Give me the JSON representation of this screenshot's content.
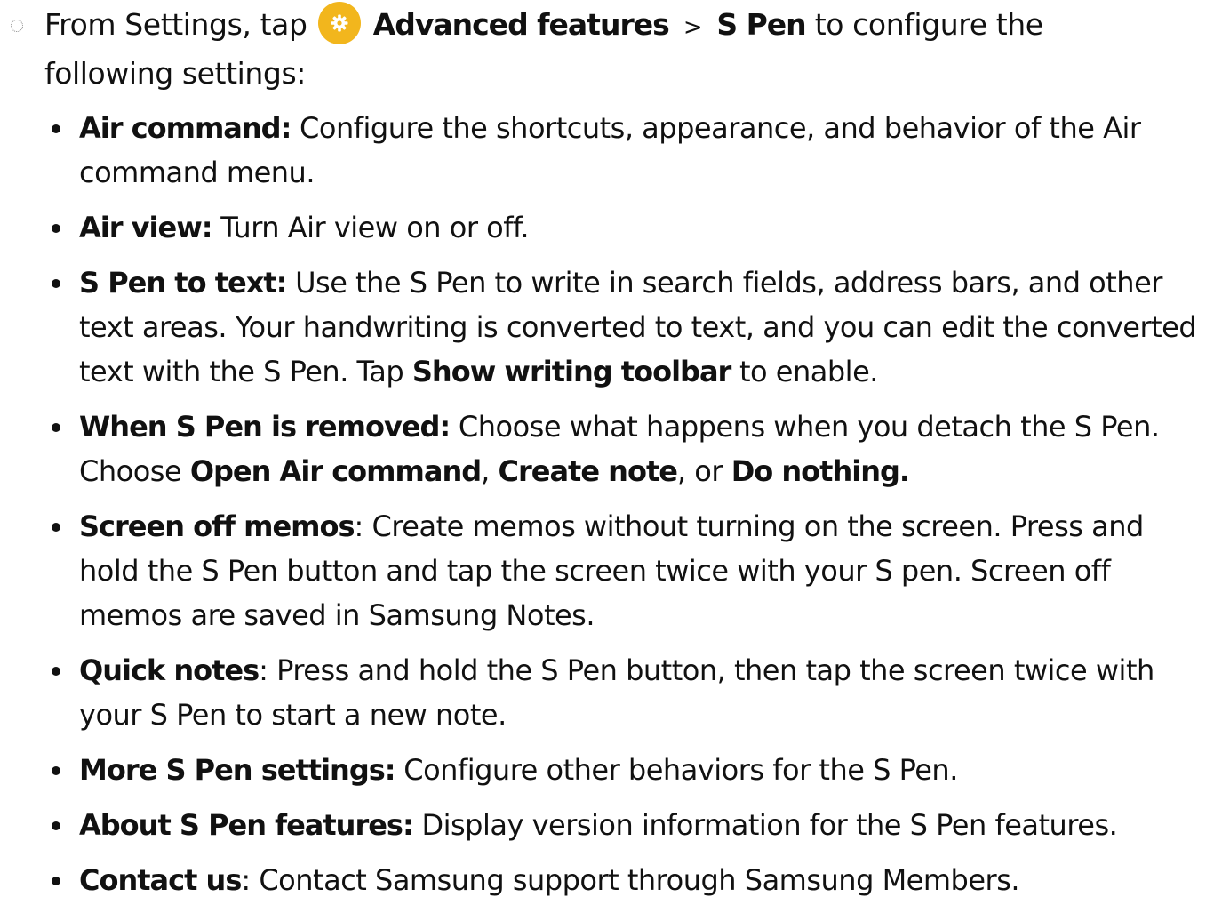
{
  "intro": {
    "text_before": "From Settings, tap",
    "link1": "Advanced features",
    "separator": ">",
    "link2": "S Pen",
    "text_after": "to configure the following settings:",
    "icon": "settings-gear-icon"
  },
  "items": [
    {
      "term": "Air command:",
      "desc": "Configure the shortcuts, appearance, and behavior of the Air command menu."
    },
    {
      "term": "Air view:",
      "desc": "Turn Air view on or off."
    },
    {
      "term": "S Pen to text:",
      "desc": "Use the S Pen to write in search fields, address bars, and other text areas. Your handwriting is converted to text, and you can edit the converted text with the S Pen. Tap",
      "bold1": "Show writing toolbar",
      "tail": "to enable."
    },
    {
      "term": "When S Pen is removed:",
      "desc": "Choose what happens when you detach the S Pen. Choose",
      "opt1": "Open Air command",
      "comma": ",",
      "opt2": "Create note",
      "or": ", or",
      "opt3": "Do nothing."
    },
    {
      "term": "Screen off memos",
      "colon": ":",
      "desc": "Create memos without turning on the screen. Press and hold the S Pen button and tap the screen twice with your S pen. Screen off memos are saved in Samsung Notes."
    },
    {
      "term": "Quick notes",
      "colon": ":",
      "desc": "Press and hold the S Pen button, then tap the screen twice with your S Pen to start a new note."
    },
    {
      "term": "More S Pen settings:",
      "desc": "Configure other behaviors for the S Pen."
    },
    {
      "term": "About S Pen features:",
      "desc": "Display version information for the S Pen features."
    },
    {
      "term": "Contact us",
      "colon": ":",
      "desc": "Contact Samsung support through Samsung Members."
    }
  ]
}
